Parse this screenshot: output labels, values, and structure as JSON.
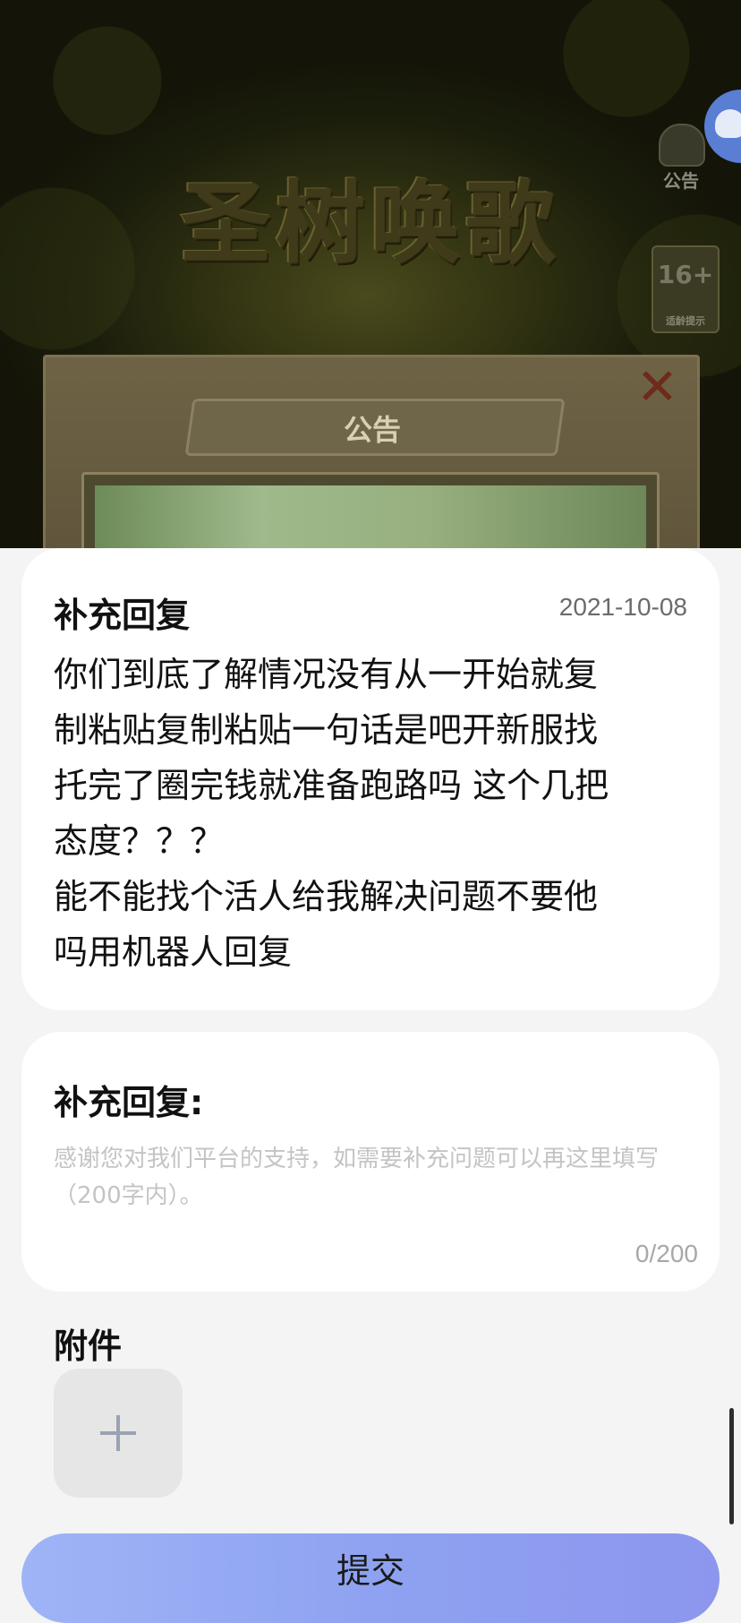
{
  "game": {
    "title": "圣树唤歌",
    "notice_label": "公告",
    "age_rating": "16+",
    "age_tip": "适龄提示",
    "dialog_title": "公告"
  },
  "reply": {
    "title": "补充回复",
    "date": "2021-10-08",
    "body": "你们到底了解情况没有从一开始就复\n制粘贴复制粘贴一句话是吧开新服找\n托完了圈完钱就准备跑路吗 这个几把\n态度？？？\n能不能找个活人给我解决问题不要他\n吗用机器人回复"
  },
  "form": {
    "label": "补充回复:",
    "placeholder": "感谢您对我们平台的支持，如需要补充问题可以再这里填写（200字内）。",
    "value": "",
    "counter": "0/200"
  },
  "attachment": {
    "label": "附件"
  },
  "submit": {
    "label": "提交"
  }
}
